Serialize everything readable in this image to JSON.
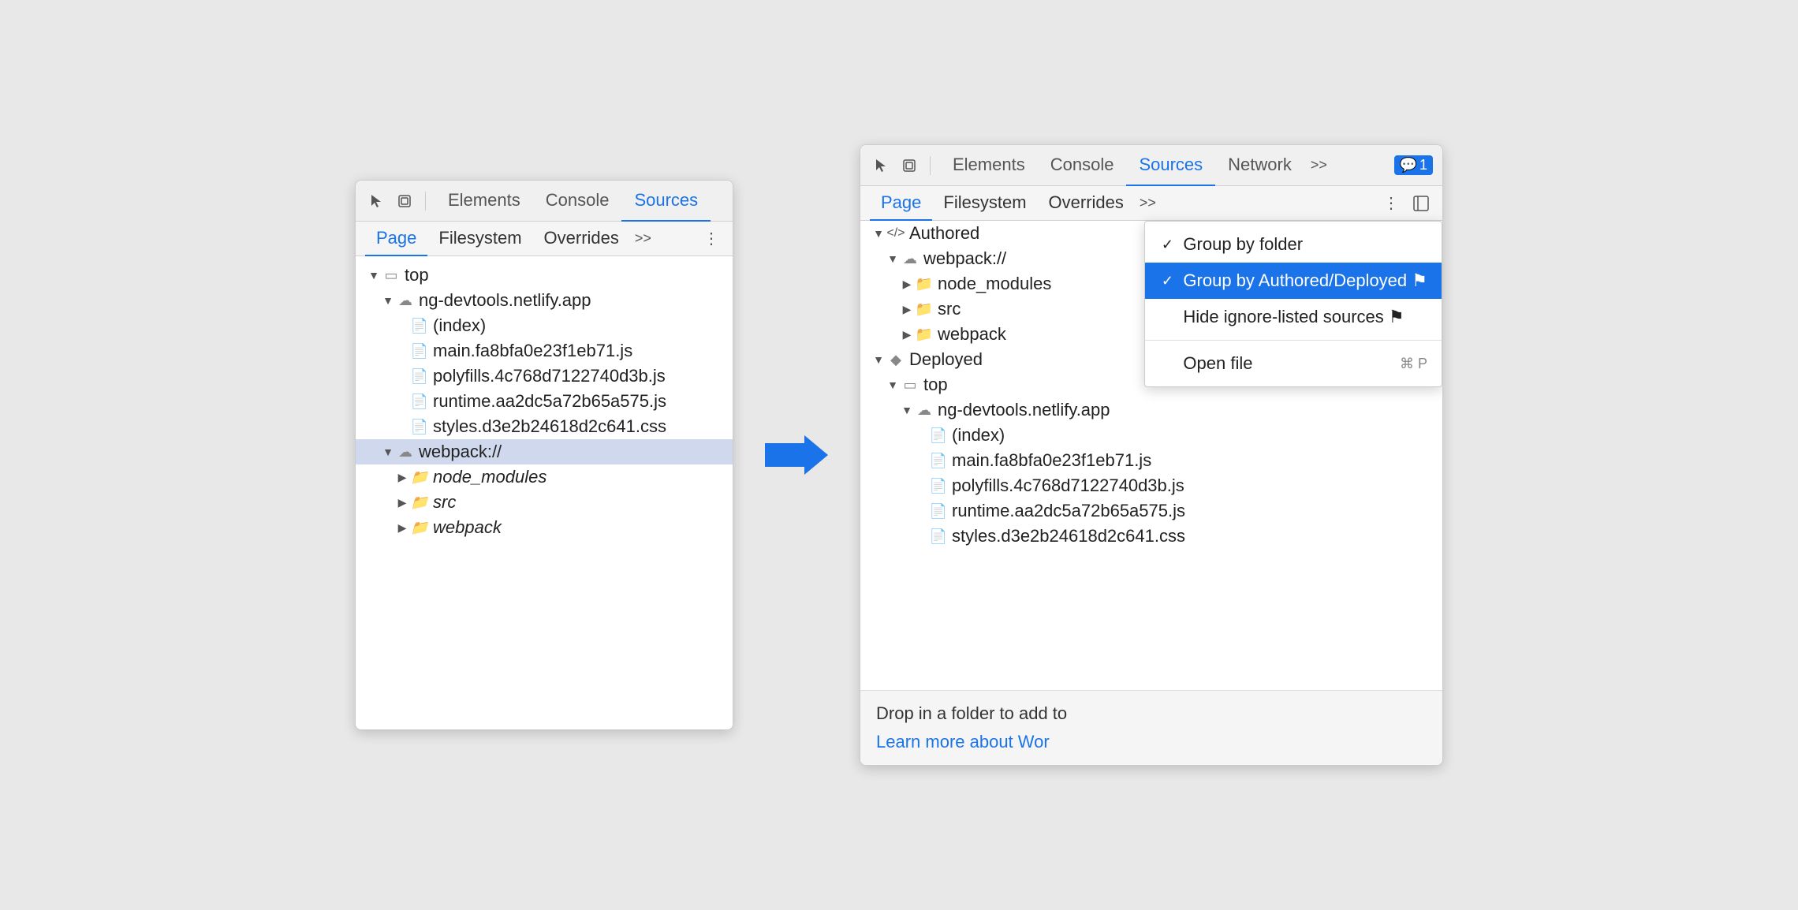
{
  "left_panel": {
    "toolbar": {
      "tabs": [
        "Elements",
        "Console",
        "Sources"
      ],
      "active_tab": "Sources"
    },
    "sub_tabs": {
      "tabs": [
        "Page",
        "Filesystem",
        "Overrides"
      ],
      "active": "Page",
      "overflow": ">>"
    },
    "tree": [
      {
        "id": "top",
        "level": 1,
        "indent": "indent-1",
        "arrow": "▼",
        "icon": "box-outline",
        "label": "top",
        "italic": false
      },
      {
        "id": "ng-netlify",
        "level": 2,
        "indent": "indent-2",
        "arrow": "▼",
        "icon": "cloud",
        "label": "ng-devtools.netlify.app",
        "italic": false
      },
      {
        "id": "index",
        "level": 3,
        "indent": "indent-3",
        "arrow": "",
        "icon": "file-gray",
        "label": "(index)",
        "italic": false
      },
      {
        "id": "main",
        "level": 3,
        "indent": "indent-3",
        "arrow": "",
        "icon": "file-yellow",
        "label": "main.fa8bfa0e23f1eb71.js",
        "italic": false
      },
      {
        "id": "polyfills",
        "level": 3,
        "indent": "indent-3",
        "arrow": "",
        "icon": "file-yellow",
        "label": "polyfills.4c768d7122740d3b.js",
        "italic": false
      },
      {
        "id": "runtime",
        "level": 3,
        "indent": "indent-3",
        "arrow": "",
        "icon": "file-yellow",
        "label": "runtime.aa2dc5a72b65a575.js",
        "italic": false
      },
      {
        "id": "styles",
        "level": 3,
        "indent": "indent-3",
        "arrow": "",
        "icon": "file-purple",
        "label": "styles.d3e2b24618d2c641.css",
        "italic": false
      },
      {
        "id": "webpack",
        "level": 2,
        "indent": "indent-2",
        "arrow": "▼",
        "icon": "cloud",
        "label": "webpack://",
        "italic": false,
        "highlighted": true
      },
      {
        "id": "node_modules",
        "level": 3,
        "indent": "indent-3",
        "arrow": "▶",
        "icon": "folder-orange",
        "label": "node_modules",
        "italic": true
      },
      {
        "id": "src",
        "level": 3,
        "indent": "indent-3",
        "arrow": "▶",
        "icon": "folder-orange",
        "label": "src",
        "italic": true
      },
      {
        "id": "webpack-folder",
        "level": 3,
        "indent": "indent-3",
        "arrow": "▶",
        "icon": "folder-orange",
        "label": "webpack",
        "italic": true
      }
    ]
  },
  "right_panel": {
    "toolbar": {
      "tabs": [
        "Elements",
        "Console",
        "Sources",
        "Network"
      ],
      "active_tab": "Sources",
      "overflow": ">>",
      "badge": "1"
    },
    "sub_tabs": {
      "tabs": [
        "Page",
        "Filesystem",
        "Overrides"
      ],
      "active": "Page",
      "overflow": ">>"
    },
    "tree": [
      {
        "id": "authored",
        "level": 1,
        "indent": "indent-1",
        "arrow": "▼",
        "icon": "code",
        "label": "Authored"
      },
      {
        "id": "webpack-authored",
        "level": 2,
        "indent": "indent-2",
        "arrow": "▼",
        "icon": "cloud",
        "label": "webpack://"
      },
      {
        "id": "node_modules2",
        "level": 3,
        "indent": "indent-3",
        "arrow": "▶",
        "icon": "folder-orange",
        "label": "node_modules"
      },
      {
        "id": "src2",
        "level": 3,
        "indent": "indent-3",
        "arrow": "▶",
        "icon": "folder-orange",
        "label": "src"
      },
      {
        "id": "webpack-folder2",
        "level": 3,
        "indent": "indent-3",
        "arrow": "▶",
        "icon": "folder-orange",
        "label": "webpack"
      },
      {
        "id": "deployed",
        "level": 1,
        "indent": "indent-1",
        "arrow": "▼",
        "icon": "cube",
        "label": "Deployed"
      },
      {
        "id": "top2",
        "level": 2,
        "indent": "indent-2",
        "arrow": "▼",
        "icon": "box-outline",
        "label": "top"
      },
      {
        "id": "ng-netlify2",
        "level": 3,
        "indent": "indent-3",
        "arrow": "▼",
        "icon": "cloud",
        "label": "ng-devtools.netlify.app"
      },
      {
        "id": "index2",
        "level": 4,
        "indent": "indent-4",
        "arrow": "",
        "icon": "file-gray",
        "label": "(index)"
      },
      {
        "id": "main2",
        "level": 4,
        "indent": "indent-4",
        "arrow": "",
        "icon": "file-yellow",
        "label": "main.fa8bfa0e23f1eb71.js"
      },
      {
        "id": "polyfills2",
        "level": 4,
        "indent": "indent-4",
        "arrow": "",
        "icon": "file-yellow",
        "label": "polyfills.4c768d7122740d3b.js"
      },
      {
        "id": "runtime2",
        "level": 4,
        "indent": "indent-4",
        "arrow": "",
        "icon": "file-yellow",
        "label": "runtime.aa2dc5a72b65a575.js"
      },
      {
        "id": "styles2",
        "level": 4,
        "indent": "indent-4",
        "arrow": "",
        "icon": "file-purple",
        "label": "styles.d3e2b24618d2c641.css"
      }
    ],
    "dropdown": {
      "items": [
        {
          "id": "group-folder",
          "label": "Group by folder",
          "checked": true,
          "selected": false,
          "shortcut": ""
        },
        {
          "id": "group-authored",
          "label": "Group by Authored/Deployed",
          "checked": true,
          "selected": true,
          "shortcut": "",
          "warning": true
        },
        {
          "id": "hide-ignore",
          "label": "Hide ignore-listed sources",
          "checked": false,
          "selected": false,
          "shortcut": "",
          "warning": true
        },
        {
          "id": "open-file",
          "label": "Open file",
          "checked": false,
          "selected": false,
          "shortcut": "⌘ P",
          "divider_before": true
        }
      ]
    },
    "filesystem": {
      "drop_text": "Drop in a folder to add to",
      "link_text": "Learn more about Wor"
    }
  },
  "icons": {
    "cursor": "⬚",
    "layers": "❑",
    "ellipsis": "⋮",
    "sidebar_icon": "⊟"
  }
}
